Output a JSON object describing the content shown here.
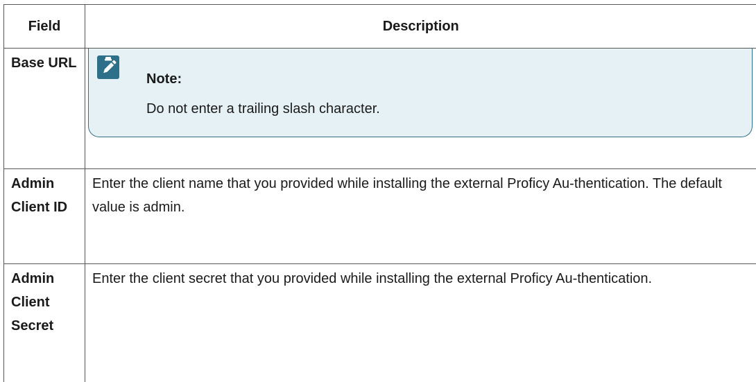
{
  "table": {
    "headers": {
      "field": "Field",
      "description": "Description"
    },
    "rows": [
      {
        "field": "Base URL",
        "note": {
          "icon": "note-clipboard-pencil-icon",
          "title": "Note:",
          "text": "Do not enter a trailing slash character."
        }
      },
      {
        "field": "Admin Client ID",
        "description": "Enter the client name that you provided while installing the external Proficy Au-thentication. The default value is admin."
      },
      {
        "field": "Admin Client Secret",
        "description": "Enter the client secret that you provided while installing the external Proficy Au-thentication."
      }
    ]
  },
  "colors": {
    "note_background": "#e6f1f5",
    "note_border": "#2e6f8a",
    "table_border": "#555555"
  }
}
